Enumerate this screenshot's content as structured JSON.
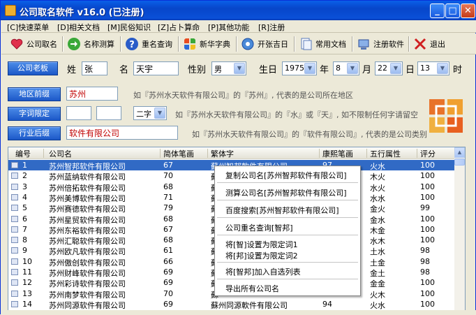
{
  "window": {
    "title": "公司取名软件 v16.0 (已注册)"
  },
  "menu": [
    "[C]快速菜单",
    "[D]相关文档",
    "[M]民俗知识",
    "[Z]占卜算命",
    "[P]其他功能",
    "[R]注册"
  ],
  "toolbar": [
    {
      "label": "公司取名",
      "icon": "heart-icon",
      "color": "#e0304c"
    },
    {
      "label": "名称测算",
      "icon": "arrow-right-icon",
      "color": "#3aa838"
    },
    {
      "label": "重名查询",
      "icon": "question-icon",
      "color": "#2a5cc8"
    },
    {
      "label": "新华字典",
      "icon": "windows-logo-icon",
      "color": "#e8a020"
    },
    {
      "label": "开张吉日",
      "icon": "gear-icon",
      "color": "#4a8ad8"
    },
    {
      "label": "常用文档",
      "icon": "document-icon",
      "color": "#8aa8d8"
    },
    {
      "label": "注册软件",
      "icon": "register-icon",
      "color": "#5a88d0"
    },
    {
      "label": "退出",
      "icon": "close-x-icon",
      "color": "#d02020"
    }
  ],
  "boss": {
    "button": "公司老板",
    "surname_label": "姓",
    "surname": "张",
    "name_label": "名",
    "name": "天宇",
    "gender_label": "性别",
    "gender": "男",
    "birth_label": "生日",
    "year": "1975",
    "year_unit": "年",
    "month": "8",
    "month_unit": "月",
    "day": "22",
    "day_unit": "日",
    "hour": "13",
    "hour_unit": "时"
  },
  "region": {
    "button": "地区前缀",
    "value": "苏州",
    "hint": "如『苏州水天软件有限公司』的『苏州』, 代表的是公司所在地区"
  },
  "chars": {
    "button": "字词限定",
    "v1": "",
    "v2": "",
    "count": "二字",
    "hint": "如『苏州水天软件有限公司』的『水』或『天』, 如不限制任何字请留空"
  },
  "industry": {
    "button": "行业后缀",
    "value": "软件有限公司",
    "hint": "如『苏州水天软件有限公司』的『软件有限公司』, 代表的是公司类别"
  },
  "table": {
    "headers": [
      "编号",
      "公司名",
      "简体笔画",
      "繁体字",
      "康熙笔画",
      "五行属性",
      "评分"
    ],
    "rows": [
      [
        "1",
        "苏州智邦软件有限公司",
        "67",
        "蘇州智邦軟件有限公司",
        "97",
        "火水",
        "100"
      ],
      [
        "2",
        "苏州蓝纳软件有限公司",
        "70",
        "蘇",
        "",
        "木火",
        "100"
      ],
      [
        "3",
        "苏州倍拓软件有限公司",
        "68",
        "蘇",
        "",
        "水火",
        "100"
      ],
      [
        "4",
        "苏州美博软件有限公司",
        "71",
        "蘇",
        "",
        "水水",
        "100"
      ],
      [
        "5",
        "苏州赛德软件有限公司",
        "79",
        "蘇",
        "",
        "金火",
        "99"
      ],
      [
        "6",
        "苏州星贸软件有限公司",
        "68",
        "蘇",
        "",
        "金水",
        "100"
      ],
      [
        "7",
        "苏州东裕软件有限公司",
        "67",
        "蘇",
        "",
        "木金",
        "100"
      ],
      [
        "8",
        "苏州汇聪软件有限公司",
        "68",
        "蘇",
        "",
        "水木",
        "100"
      ],
      [
        "9",
        "苏州欧凡软件有限公司",
        "61",
        "蘇",
        "",
        "土水",
        "98"
      ],
      [
        "10",
        "苏州傲创软件有限公司",
        "66",
        "蘇",
        "",
        "土金",
        "98"
      ],
      [
        "11",
        "苏州财峰软件有限公司",
        "69",
        "蘇",
        "",
        "金土",
        "98"
      ],
      [
        "12",
        "苏州彩诗软件有限公司",
        "69",
        "蘇",
        "",
        "金金",
        "100"
      ],
      [
        "13",
        "苏州南梦软件有限公司",
        "70",
        "蘇",
        "",
        "火木",
        "100"
      ],
      [
        "14",
        "苏州同源软件有限公司",
        "69",
        "蘇州同源軟件有限公司",
        "94",
        "火水",
        "100"
      ]
    ]
  },
  "context_menu": [
    "复制公司名[苏州智邦软件有限公司]",
    "测算公司名[苏州智邦软件有限公司]",
    "百度搜索[苏州智邦软件有限公司]",
    "公司重名查询[智邦]",
    "将[智]设置为限定词1",
    "将[邦]设置为限定词2",
    "将[智邦]加入自选列表",
    "导出所有公司名"
  ]
}
